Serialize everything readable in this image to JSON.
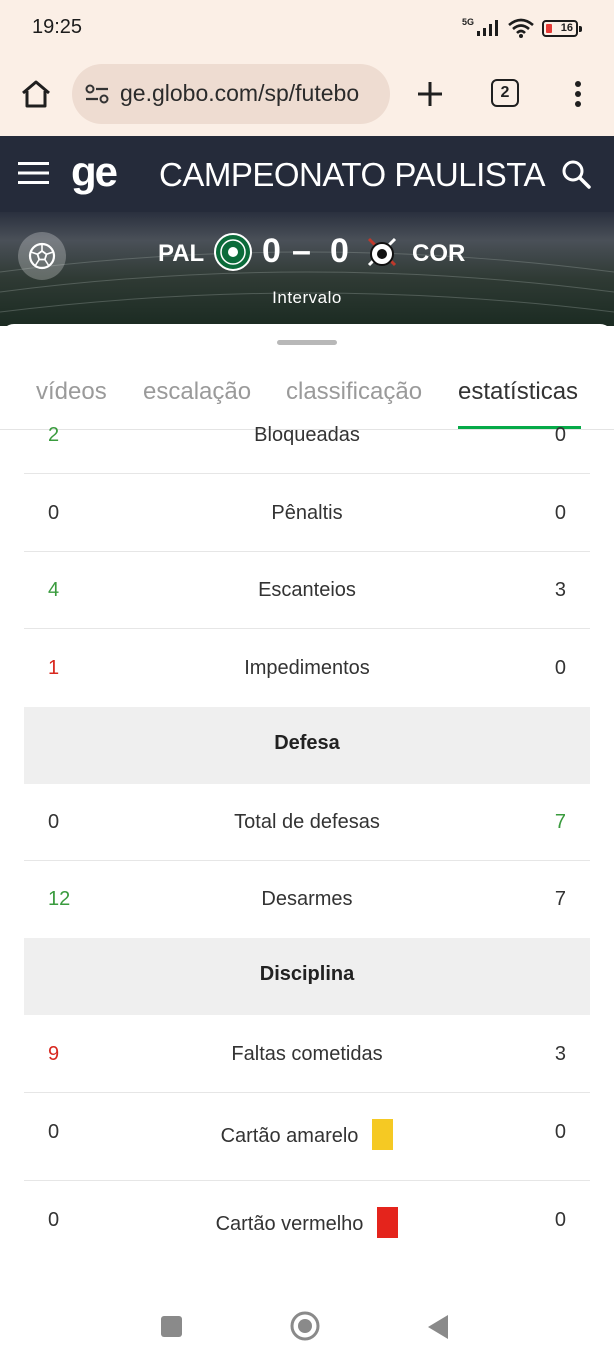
{
  "status_bar": {
    "time": "19:25",
    "network": "5G",
    "battery": "16"
  },
  "browser": {
    "url": "ge.globo.com/sp/futebo",
    "tab_count": "2"
  },
  "header": {
    "logo": "ge",
    "title": "CAMPEONATO PAULISTA"
  },
  "match": {
    "home_team": "PAL",
    "home_score": "0",
    "separator": "–",
    "away_score": "0",
    "away_team": "COR",
    "status": "Intervalo"
  },
  "tabs": [
    {
      "label": "vídeos"
    },
    {
      "label": "escalação"
    },
    {
      "label": "classificação"
    },
    {
      "label": "estatísticas"
    }
  ],
  "stats": {
    "bloqueadas": {
      "label": "Bloqueadas",
      "home": "2",
      "away": "0"
    },
    "penaltis": {
      "label": "Pênaltis",
      "home": "0",
      "away": "0"
    },
    "escanteios": {
      "label": "Escanteios",
      "home": "4",
      "away": "3"
    },
    "impedimentos": {
      "label": "Impedimentos",
      "home": "1",
      "away": "0"
    },
    "defesa_section": "Defesa",
    "total_defesas": {
      "label": "Total de defesas",
      "home": "0",
      "away": "7"
    },
    "desarmes": {
      "label": "Desarmes",
      "home": "12",
      "away": "7"
    },
    "disciplina_section": "Disciplina",
    "faltas": {
      "label": "Faltas cometidas",
      "home": "9",
      "away": "3"
    },
    "amarelo": {
      "label": "Cartão amarelo",
      "home": "0",
      "away": "0"
    },
    "vermelho": {
      "label": "Cartão vermelho",
      "home": "0",
      "away": "0"
    }
  },
  "colors": {
    "accent_green": "#06aa48",
    "leader_green": "#3a9b3e",
    "negative_red": "#d8281f",
    "header_bg": "#252b3a"
  }
}
